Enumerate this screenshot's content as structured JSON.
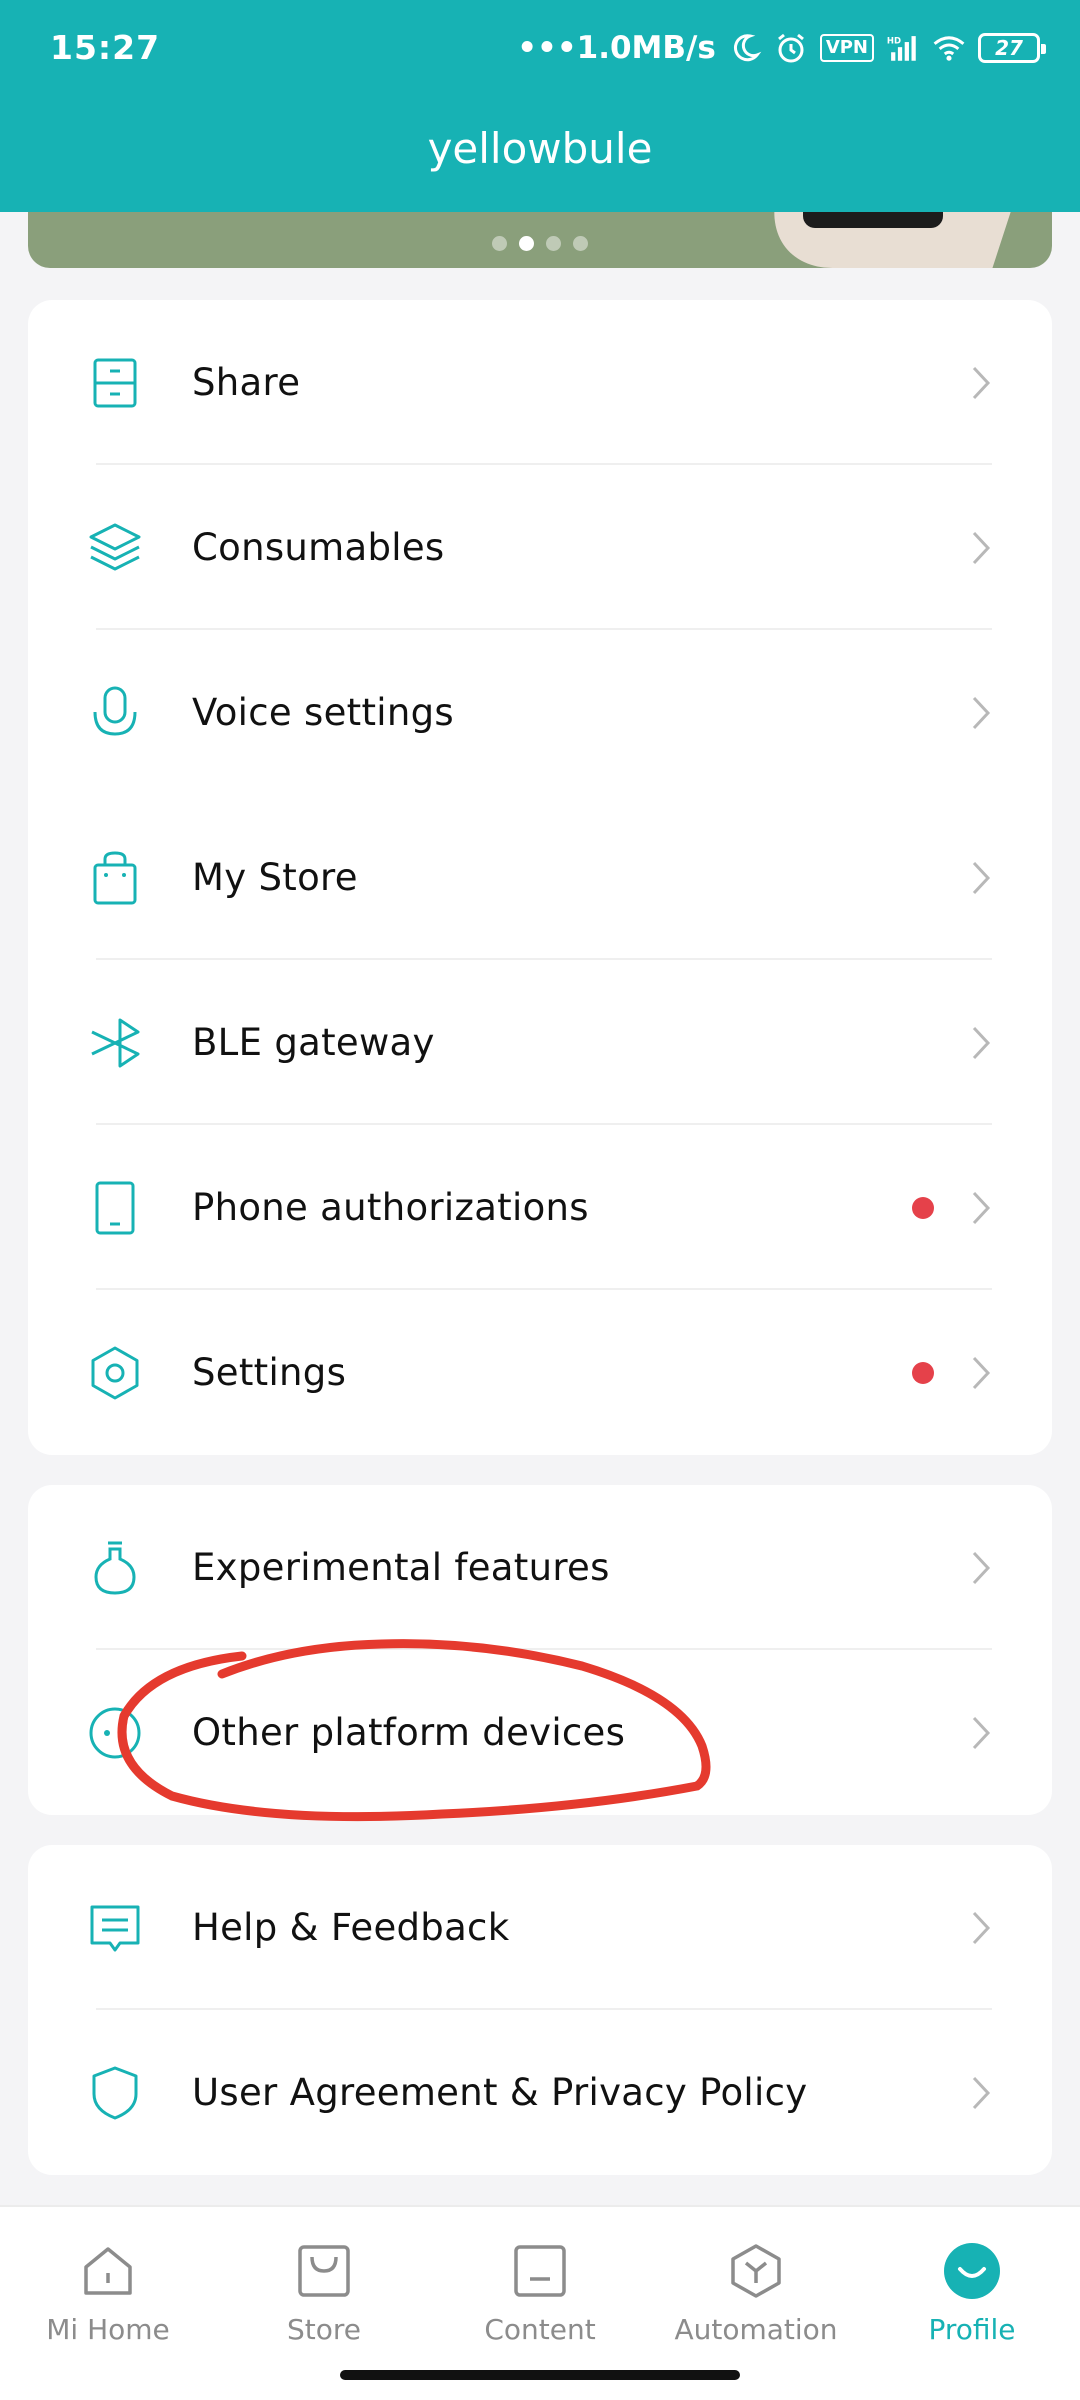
{
  "status_bar": {
    "time": "15:27",
    "network_speed": "•••1.0MB/s",
    "vpn": "VPN",
    "hd": "HD",
    "battery": "27"
  },
  "header": {
    "title": "yellowbule"
  },
  "banner": {
    "dots": 4,
    "active_dot": 2
  },
  "colors": {
    "accent": "#17b2b4",
    "badge": "#e5414a",
    "annotation": "#e53a2e"
  },
  "menu_groups": [
    {
      "items": [
        {
          "label": "Share",
          "icon": "share-cabinet-icon",
          "badge": false
        },
        {
          "label": "Consumables",
          "icon": "layers-icon",
          "badge": false
        },
        {
          "label": "Voice settings",
          "icon": "microphone-icon",
          "badge": false
        },
        {
          "label": "My Store",
          "icon": "shopping-bag-icon",
          "badge": false
        },
        {
          "label": "BLE gateway",
          "icon": "bluetooth-icon",
          "badge": false
        },
        {
          "label": "Phone authorizations",
          "icon": "phone-icon",
          "badge": true
        },
        {
          "label": "Settings",
          "icon": "hexagon-gear-icon",
          "badge": true
        }
      ]
    },
    {
      "items": [
        {
          "label": "Experimental features",
          "icon": "flask-icon",
          "badge": false
        },
        {
          "label": "Other platform devices",
          "icon": "devices-face-icon",
          "badge": false
        }
      ]
    },
    {
      "items": [
        {
          "label": "Help & Feedback",
          "icon": "chat-bubble-icon",
          "badge": false
        },
        {
          "label": "User Agreement & Privacy Policy",
          "icon": "shield-icon",
          "badge": false
        }
      ]
    }
  ],
  "bottom_nav": [
    {
      "label": "Mi Home",
      "icon": "home-icon",
      "active": false
    },
    {
      "label": "Store",
      "icon": "store-bag-icon",
      "active": false
    },
    {
      "label": "Content",
      "icon": "content-icon",
      "active": false
    },
    {
      "label": "Automation",
      "icon": "automation-icon",
      "active": false
    },
    {
      "label": "Profile",
      "icon": "profile-smile-icon",
      "active": true
    }
  ]
}
